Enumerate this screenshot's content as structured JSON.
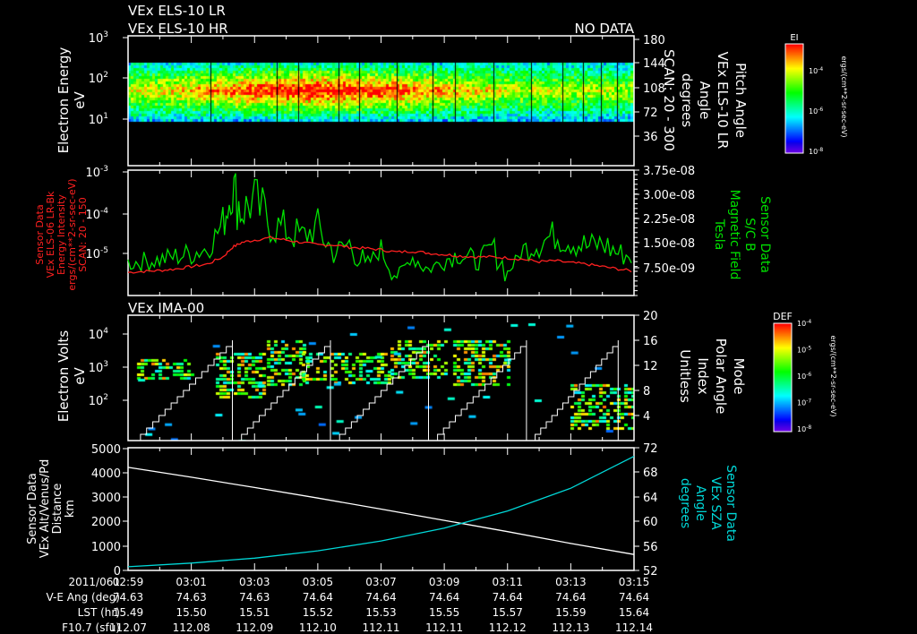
{
  "header": {
    "title_lr": "VEx ELS-10 LR",
    "title_hr": "VEx ELS-10 HR",
    "no_data": "NO DATA"
  },
  "colors": {
    "background": "#000000",
    "axes": "#ffffff",
    "red_series": "#ff2020",
    "green_series": "#00e000",
    "cyan_series": "#00d8d8"
  },
  "chart_data": [
    {
      "type": "heatmap",
      "name": "els-spectrogram",
      "ylabel": [
        "Electron Energy",
        "eV"
      ],
      "y_ticks": [
        "10^3",
        "10^2",
        "10^1"
      ],
      "right_axis": {
        "ticks": [
          "180",
          "144",
          "108",
          "72",
          "36"
        ],
        "label": [
          "Pitch Angle",
          "VEx ELS-10 LR",
          "Angle",
          "degrees",
          "SCAN: 20 - 300"
        ]
      },
      "colorbar": {
        "title": "EI",
        "ticks": [
          "10^-4",
          "10^-6",
          "10^-8"
        ],
        "unit": "ergs/(cm**2-sr-sec-eV)"
      }
    },
    {
      "type": "line",
      "name": "els-bk-and-b-field",
      "left_label": [
        "Sensor Data",
        "VEx ELS-06 LR-Bk",
        "Energy Intensity",
        "ergs/(cm**2-sr-sec-eV)",
        "SCAN: 20 - 150"
      ],
      "left_ticks": [
        "10^-3",
        "10^-4",
        "10^-5"
      ],
      "left_ylim_log10": [
        -5.6,
        -3
      ],
      "right_label": [
        "Sensor Data",
        "S/C B",
        "Magnetic Field",
        "Tesla"
      ],
      "right_ticks": [
        "3.75e-08",
        "3.00e-08",
        "2.25e-08",
        "1.50e-08",
        "7.50e-09"
      ],
      "right_ylim": [
        0,
        3.75e-08
      ],
      "x_minutes": [
        0,
        0.5,
        1,
        1.5,
        2,
        2.5,
        3,
        3.3,
        3.6,
        4,
        4.5,
        5,
        5.5,
        6,
        6.5,
        7,
        7.5,
        8,
        8.5,
        9,
        9.5,
        10,
        10.5,
        11,
        11.5,
        12,
        12.5,
        13,
        13.5,
        14,
        14.5,
        15,
        15.5,
        16
      ],
      "series": [
        {
          "name": "Energy Intensity (log10)",
          "axis": "left",
          "values": [
            -5.12,
            -5.1,
            -5.08,
            -5.05,
            -5.0,
            -4.95,
            -4.8,
            -4.6,
            -4.5,
            -4.45,
            -4.4,
            -4.45,
            -4.5,
            -4.55,
            -4.55,
            -4.6,
            -4.62,
            -4.65,
            -4.7,
            -4.68,
            -4.72,
            -4.75,
            -4.78,
            -4.8,
            -4.8,
            -4.82,
            -4.85,
            -4.9,
            -4.88,
            -4.92,
            -4.95,
            -5.0,
            -5.05,
            -5.1
          ]
        },
        {
          "name": "Magnetic Field (T)",
          "axis": "right",
          "values": [
            1e-08,
            1.05e-08,
            1.1e-08,
            1.2e-08,
            1.3e-08,
            1.45e-08,
            2.2e-08,
            3.3e-08,
            2.6e-08,
            2.9e-08,
            2.2e-08,
            2e-08,
            1.8e-08,
            2.1e-08,
            1.3e-08,
            1.6e-08,
            9e-09,
            1.4e-08,
            6e-09,
            1.2e-08,
            8e-09,
            1.1e-08,
            1.3e-08,
            1e-08,
            1.5e-08,
            7e-09,
            1.4e-08,
            1.6e-08,
            1.9e-08,
            1.7e-08,
            1.5e-08,
            1.6e-08,
            1.3e-08,
            1.2e-08
          ]
        }
      ]
    },
    {
      "type": "heatmap",
      "name": "ima-spectrogram",
      "panel_title": "VEx IMA-00",
      "ylabel": [
        "Electron Volts",
        "eV"
      ],
      "y_ticks": [
        "10^4",
        "10^3",
        "10^2"
      ],
      "right_axis": {
        "ticks": [
          "20",
          "16",
          "12",
          "8",
          "4"
        ],
        "ylim": [
          0,
          20
        ],
        "label": [
          "Mode",
          "Polar Angle",
          "Index",
          "Unitless"
        ]
      },
      "mode_ramps_minutes": [
        [
          0.2,
          3.3
        ],
        [
          3.4,
          6.4
        ],
        [
          6.5,
          9.5
        ],
        [
          9.6,
          12.6
        ],
        [
          12.7,
          15.5
        ]
      ],
      "mode_ramp_max": 16,
      "colorbar": {
        "title": "DEF",
        "ticks": [
          "10^-4",
          "10^-5",
          "10^-6",
          "10^-7",
          "10^-8"
        ],
        "unit": "ergs/(cm**2-sr-sec-eV)"
      }
    },
    {
      "type": "line",
      "name": "altitude-and-sza",
      "left_label": [
        "Sensor Data",
        "VEx Alt/Venus/Pd",
        "Distance",
        "km"
      ],
      "left_ticks": [
        "5000",
        "4000",
        "3000",
        "2000",
        "1000",
        "0"
      ],
      "left_ylim": [
        0,
        5000
      ],
      "right_label": [
        "Sensor Data",
        "VEx SZA",
        "Angle",
        "degrees"
      ],
      "right_ticks": [
        "72",
        "68",
        "64",
        "60",
        "56",
        "52"
      ],
      "right_ylim": [
        52,
        72
      ],
      "x_minutes": [
        0,
        2,
        4,
        6,
        8,
        10,
        12,
        14,
        16
      ],
      "series": [
        {
          "name": "Altitude (km)",
          "axis": "left",
          "values": [
            4200,
            3800,
            3380,
            2950,
            2500,
            2040,
            1580,
            1100,
            650
          ]
        },
        {
          "name": "SZA (deg)",
          "axis": "right",
          "values": [
            52.6,
            53.2,
            54.0,
            55.2,
            56.8,
            58.9,
            61.7,
            65.4,
            70.6
          ]
        }
      ]
    }
  ],
  "x_axis": {
    "row_labels": [
      "2011/061",
      "V-E Ang (deg)",
      "LST (hr)",
      "F10.7 (sfu)"
    ],
    "times": [
      "02:59",
      "03:01",
      "03:03",
      "03:05",
      "03:07",
      "03:09",
      "03:11",
      "03:13",
      "03:15"
    ],
    "ve_ang": [
      "74.63",
      "74.63",
      "74.63",
      "74.64",
      "74.64",
      "74.64",
      "74.64",
      "74.64",
      "74.64"
    ],
    "lst": [
      "15.49",
      "15.50",
      "15.51",
      "15.52",
      "15.53",
      "15.55",
      "15.57",
      "15.59",
      "15.64"
    ],
    "f107": [
      "112.07",
      "112.08",
      "112.09",
      "112.10",
      "112.11",
      "112.11",
      "112.12",
      "112.13",
      "112.14"
    ]
  }
}
